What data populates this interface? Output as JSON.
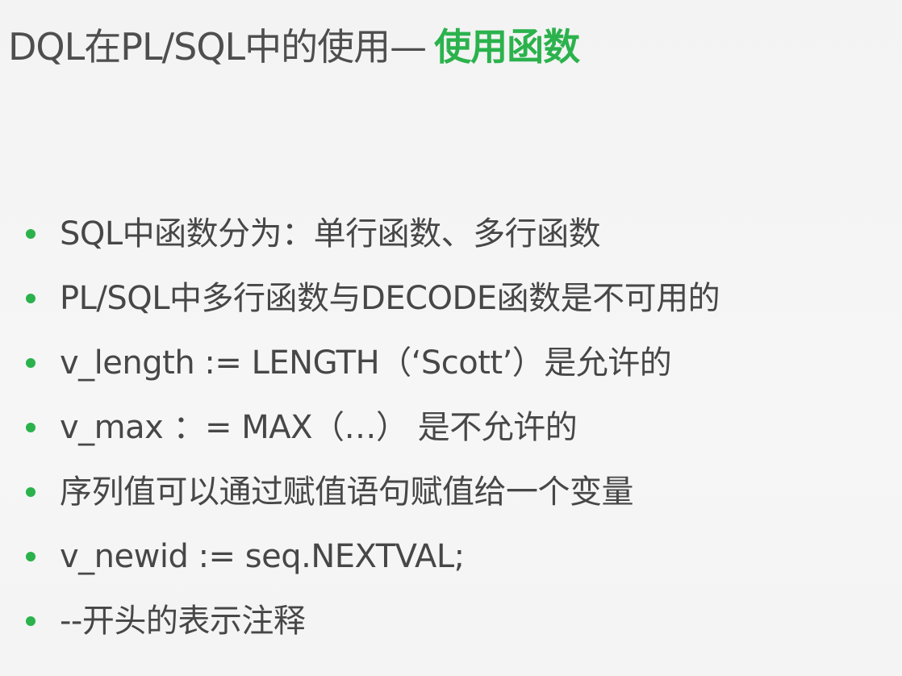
{
  "title": {
    "main": "DQL在PL/SQL中的使用—",
    "accent": "使用函数"
  },
  "colors": {
    "accent": "#2bb24c",
    "text": "#474747",
    "background": "#f5f5f5"
  },
  "bullets": [
    "SQL中函数分为：单行函数、多行函数",
    "PL/SQL中多行函数与DECODE函数是不可用的",
    "v_length := LENGTH（‘Scott’）是允许的",
    "v_max ：= MAX（…） 是不允许的",
    "序列值可以通过赋值语句赋值给一个变量",
    "v_newid := seq.NEXTVAL;",
    "--开头的表示注释"
  ]
}
